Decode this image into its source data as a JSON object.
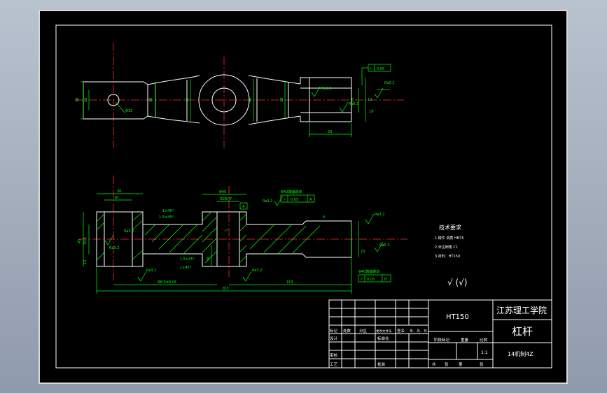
{
  "title_block": {
    "school": "江苏理工学院",
    "part_name": "杠杆",
    "material": "HT150",
    "drawing_no": "14机制4Z",
    "scale": "1:1",
    "labels": {
      "mark": "标记",
      "count": "处数",
      "zone": "分区",
      "doc_no": "更改文件号",
      "sign": "签名",
      "date": "年、月、日",
      "design": "设计",
      "std": "标准化",
      "stage": "阶段标记",
      "weight": "重量",
      "scale": "比例",
      "check": "审核",
      "process": "工艺",
      "approve": "批准",
      "total": "共",
      "sheets": "张",
      "page": "第",
      "sheet": "张"
    }
  },
  "tech_req": {
    "title": "技术要求",
    "items": [
      "1.铸件 调质 HB75",
      "2.未注倒角 C1",
      "3.材料：HT150"
    ]
  },
  "roughness_note": "√ (√)",
  "dims_top": {
    "d_left_outer": "38",
    "d_left_inner": "16",
    "hole": "Φ15",
    "d_mid1": "38",
    "d_mid2": "38",
    "d_mid3": "38",
    "d_right": "38",
    "r1": "Ra3.2",
    "r2": "Ra6.3",
    "r3": "Ra3.2",
    "tol": "0.05",
    "flat": "f",
    "w33": "33",
    "d15": "15",
    "d19": "19",
    "d13": "13"
  },
  "dims_side": {
    "d36": "36",
    "d20": "20",
    "d5": "5",
    "phi40": "Φ40",
    "phi26": "Φ26H7",
    "tol_label": "Φ40端面跳动",
    "tol_val": "0.05",
    "tol_ref": "A",
    "c1": "1.5×45°",
    "c2": "1×45°",
    "c3": "1.5×45°",
    "c4": "1×45°",
    "d68": "Φ8.5±0.05",
    "total": "203",
    "d163": "163",
    "d4": "4",
    "d45": "45",
    "d23": "23",
    "d13": "13",
    "d16": "16",
    "d19": "19.5",
    "bottom_tol_label": "Φ40端面跳动",
    "bottom_tol": "0.05",
    "bottom_ref": "B",
    "ra1": "Ra3.2",
    "ra2": "Ra3.2",
    "ra3": "Ra6.3",
    "ra4": "Ra3.2",
    "ra5": "Ra3.2",
    "ra6": "Ra3.2",
    "ra7": "Ra3.2"
  }
}
